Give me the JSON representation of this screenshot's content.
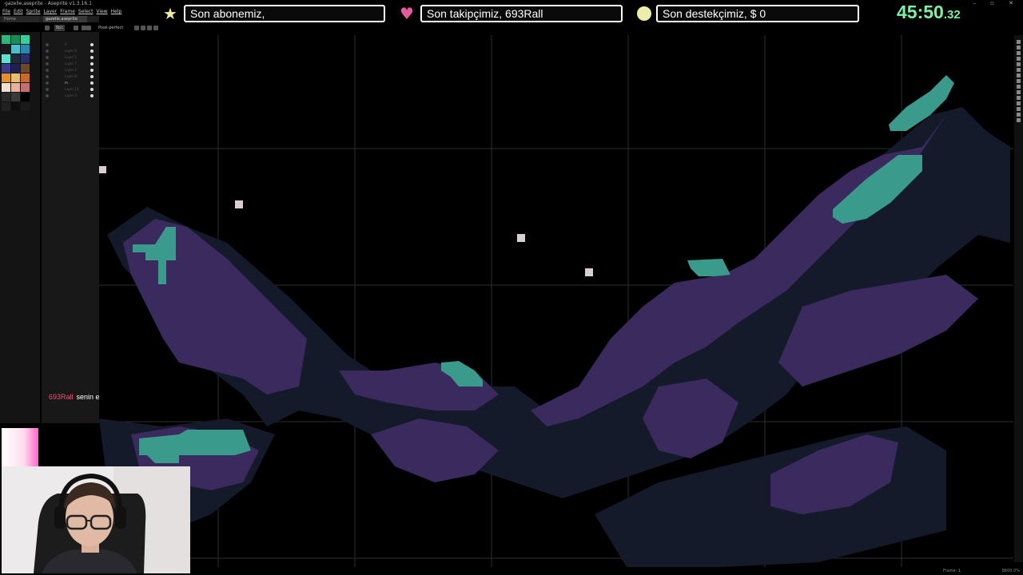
{
  "app": {
    "title": "gazelle.aseprite - Aseprite v1.3.16.1",
    "menu": [
      "File",
      "Edit",
      "Sprite",
      "Layer",
      "Frame",
      "Select",
      "View",
      "Help"
    ],
    "tabs": {
      "home": "Home",
      "file": "gazelle.aseprite"
    },
    "window_controls": "– ▫ ✕"
  },
  "toolbar": {
    "bpc": "8pc",
    "pixel_perfect": "Pixel-perfect"
  },
  "palette": {
    "colors": [
      "#2fb67c",
      "#1e8a5c",
      "#3acf9a",
      "#1a1a1a",
      "#4bbfcf",
      "#2b88b0",
      "#5fe0d0",
      "#222a3a",
      "#2a2e6a",
      "#3a3a8a",
      "#1f1f50",
      "#6a4a2a",
      "#e09030",
      "#e0c070",
      "#c86a30",
      "#f0e0d0",
      "#e8b0a0",
      "#c07070",
      "#2a2a2a",
      "#3a3a3a",
      "#000000",
      "#222222",
      "#0f0f0f",
      "#1a1a1a"
    ]
  },
  "layers": [
    {
      "label": "0",
      "selected": false
    },
    {
      "label": "Layer 6",
      "selected": false
    },
    {
      "label": "Layer 5",
      "selected": false
    },
    {
      "label": "Layer 7",
      "selected": false
    },
    {
      "label": "Layer 2",
      "selected": false
    },
    {
      "label": "Layer 8",
      "selected": false
    },
    {
      "label": "m",
      "selected": true
    },
    {
      "label": "Layer 10",
      "selected": false
    },
    {
      "label": "Layer 3",
      "selected": false
    }
  ],
  "chat": {
    "user": "693Rall",
    "message": "senin elinde o"
  },
  "overlay": {
    "subscriber": "Son abonemiz,",
    "follower": "Son takipçimiz, 693Rall",
    "donor": "Son destekçimiz,  $ 0",
    "timer_main": "45:50",
    "timer_frac": ".32",
    "colors": {
      "timer": "#7df0a8",
      "heart": "#e85aa0",
      "star": "#f0e8a0",
      "coin": "#eeeeaa"
    }
  },
  "status": {
    "frame_label": "Frame:",
    "frame_value": "1",
    "zoom": "8600.0%"
  }
}
